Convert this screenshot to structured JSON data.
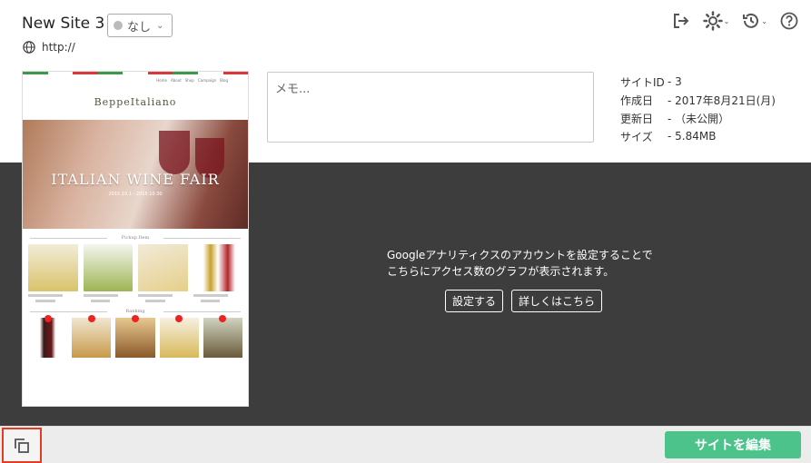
{
  "site": {
    "title": "New Site 3",
    "url": "http://"
  },
  "status": {
    "selected": "なし"
  },
  "toolbar": {
    "icons": [
      "sign-out-icon",
      "gear-icon",
      "history-icon",
      "help-icon"
    ]
  },
  "memo": {
    "placeholder": "メモ..."
  },
  "info": {
    "rows": [
      {
        "key": "サイトID",
        "value": "- 3"
      },
      {
        "key": "作成日",
        "value": "- 2017年8月21日(月)"
      },
      {
        "key": "更新日",
        "value": "- （未公開）"
      },
      {
        "key": "サイズ",
        "value": "- 5.84MB"
      }
    ]
  },
  "thumbnail": {
    "nav": [
      "Home",
      "About",
      "Shop",
      "Campaign",
      "Blog"
    ],
    "brand": "BeppeItaliano",
    "hero_title": "ITALIAN WINE FAIR",
    "hero_sub": "2015.10.1 - 2015.10.30",
    "pickup_heading": "Pickup Item",
    "ranking_heading": "Ranking"
  },
  "analytics": {
    "line1": "Googleアナリティクスのアカウントを設定することで",
    "line2": "こちらにアクセス数のグラフが表示されます。",
    "setup_label": "設定する",
    "more_label": "詳しくはこちら"
  },
  "footer": {
    "edit_label": "サイトを編集"
  },
  "colors": {
    "accent": "#4cc38a",
    "dark_panel": "#3d3d3d",
    "highlight": "#e53b22"
  }
}
